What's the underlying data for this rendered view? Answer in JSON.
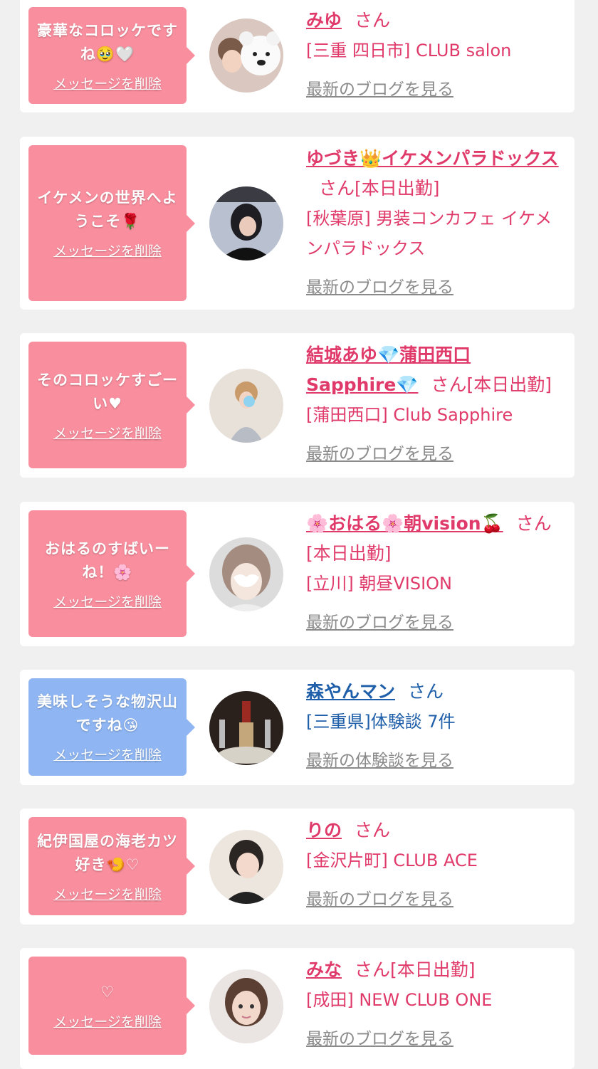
{
  "theme": {
    "pink": "#f98e9e",
    "blue": "#8fb6f3",
    "name_pink": "#e03a6a",
    "name_blue": "#1f5fa9",
    "link_gray": "#8a8a8a"
  },
  "cards": [
    {
      "message": "豪華なコロッケですね🥹🤍",
      "delete": "メッセージを削除",
      "name": "みゆ",
      "san": "さん",
      "shop": "[三重 四日市] CLUB salon",
      "link": "最新のブログを見る",
      "avatar": "avatar-photo-bear-filter"
    },
    {
      "message": "イケメンの世界へようこそ🌹",
      "delete": "メッセージを削除",
      "name": "ゆづき👑イケメンパラドックス",
      "san": "さん[本日出勤]",
      "shop": "[秋葉原] 男装コンカフェ イケメンパラドックス",
      "link": "最新のブログを見る",
      "avatar": "avatar-photo-dark"
    },
    {
      "message": "そのコロッケすごーい♥",
      "delete": "メッセージを削除",
      "name": "結城あゆ💎蒲田西口Sapphire💎",
      "san": "さん[本日出勤]",
      "shop": "[蒲田西口] Club Sapphire",
      "link": "最新のブログを見る",
      "avatar": "avatar-photo-dress"
    },
    {
      "message": "おはるのすばいーね！🌸",
      "delete": "メッセージを削除",
      "name": "🌸おはる🌸朝vision🍒",
      "san": "さん",
      "extra": "[本日出勤]",
      "shop": "[立川] 朝昼VISION",
      "link": "最新のブログを見る",
      "avatar": "avatar-photo-hair"
    },
    {
      "message": "美味しそうな物沢山ですね😘",
      "delete": "メッセージを削除",
      "name": "森やんマン",
      "san": "さん",
      "shop": "[三重県]体験談 7件",
      "link": "最新の体験談を見る",
      "avatar": "avatar-photo-bottle"
    },
    {
      "message": "紀伊国屋の海老カツ好き🍤♡",
      "delete": "メッセージを削除",
      "name": "りの",
      "san": "さん",
      "shop": "[金沢片町] CLUB ACE",
      "link": "最新のブログを見る",
      "avatar": "avatar-photo-girl"
    },
    {
      "message": "♡",
      "delete": "メッセージを削除",
      "name": "みな",
      "san": "さん[本日出勤]",
      "shop": "[成田] NEW CLUB ONE",
      "link": "最新のブログを見る",
      "avatar": "avatar-photo-portrait"
    }
  ]
}
